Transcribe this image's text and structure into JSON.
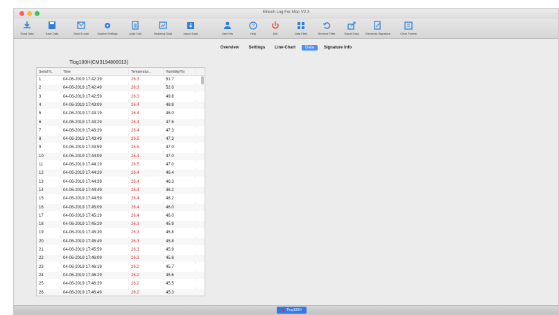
{
  "window": {
    "title": "Elitech Log For Mac V2.3"
  },
  "toolbar": {
    "items": [
      {
        "label": "Read Data",
        "icon": "download-icon"
      },
      {
        "label": "Save Data",
        "icon": "save-icon"
      },
      {
        "label": "Send E-mail",
        "icon": "email-icon"
      },
      {
        "label": "System Settings",
        "icon": "gear-icon"
      },
      {
        "label": "Audit Trail",
        "icon": "clipboard-icon"
      },
      {
        "label": "Historical Data",
        "icon": "history-icon"
      },
      {
        "label": "Import Data",
        "icon": "import-icon"
      },
      {
        "label": "User Info",
        "icon": "user-icon"
      },
      {
        "label": "Help",
        "icon": "help-icon"
      },
      {
        "label": "Exit",
        "icon": "power-icon"
      },
      {
        "label": "Data Filter",
        "icon": "filter-icon"
      },
      {
        "label": "Remove Filter",
        "icon": "undo-icon"
      },
      {
        "label": "Export Data",
        "icon": "export-icon"
      },
      {
        "label": "Electronic Signature",
        "icon": "signature-icon"
      },
      {
        "label": "Clear Format",
        "icon": "format-icon"
      }
    ]
  },
  "tabs": [
    "Overview",
    "Settings",
    "Line-Chart",
    "Data",
    "Signature Info"
  ],
  "active_tab": "Data",
  "panel": {
    "title": "Tlog100H(CM3194800013)"
  },
  "table": {
    "headers": [
      "Serial N..",
      "Time",
      "Temperatur...",
      "Humidity(%)"
    ],
    "rows": [
      [
        "1",
        "04-06-2019 17:42:39",
        "26.3",
        "51.7"
      ],
      [
        "2",
        "04-06-2019 17:42:49",
        "26.3",
        "52.0"
      ],
      [
        "3",
        "04-06-2019 17:42:59",
        "26.3",
        "49.8"
      ],
      [
        "4",
        "04-06-2019 17:43:09",
        "26.4",
        "48.8"
      ],
      [
        "5",
        "04-06-2019 17:43:19",
        "26.4",
        "48.0"
      ],
      [
        "6",
        "04-06-2019 17:43:29",
        "26.4",
        "47.6"
      ],
      [
        "7",
        "04-06-2019 17:43:39",
        "26.4",
        "47.3"
      ],
      [
        "8",
        "04-06-2019 17:43:49",
        "26.5",
        "47.3"
      ],
      [
        "9",
        "04-06-2019 17:43:59",
        "26.5",
        "47.0"
      ],
      [
        "10",
        "04-06-2019 17:44:09",
        "26.4",
        "47.0"
      ],
      [
        "11",
        "04-06-2019 17:44:19",
        "26.5",
        "47.0"
      ],
      [
        "12",
        "04-06-2019 17:44:29",
        "26.4",
        "46.4"
      ],
      [
        "13",
        "04-06-2019 17:44:39",
        "26.4",
        "46.3"
      ],
      [
        "14",
        "04-06-2019 17:44:49",
        "26.4",
        "46.2"
      ],
      [
        "15",
        "04-06-2019 17:44:59",
        "26.4",
        "46.2"
      ],
      [
        "16",
        "04-06-2019 17:45:09",
        "26.4",
        "46.0"
      ],
      [
        "17",
        "04-06-2019 17:45:19",
        "26.4",
        "46.0"
      ],
      [
        "18",
        "04-06-2019 17:45:29",
        "26.3",
        "45.9"
      ],
      [
        "19",
        "04-06-2019 17:45:39",
        "26.3",
        "45.8"
      ],
      [
        "20",
        "04-06-2019 17:45:49",
        "26.3",
        "45.8"
      ],
      [
        "21",
        "04-06-2019 17:45:59",
        "26.3",
        "45.9"
      ],
      [
        "22",
        "04-06-2019 17:46:09",
        "26.3",
        "45.8"
      ],
      [
        "23",
        "04-06-2019 17:46:19",
        "26.2",
        "45.7"
      ],
      [
        "24",
        "04-06-2019 17:46:29",
        "26.2",
        "45.6"
      ],
      [
        "25",
        "04-06-2019 17:46:39",
        "26.2",
        "45.5"
      ],
      [
        "26",
        "04-06-2019 17:46:49",
        "26.2",
        "45.3"
      ]
    ]
  },
  "status": {
    "device_tab": "Tlog100H"
  },
  "colors": {
    "accent": "#4c8df6",
    "temperature": "#e02a2a",
    "icon": "#2f7fd8",
    "exit": "#e0403a"
  }
}
